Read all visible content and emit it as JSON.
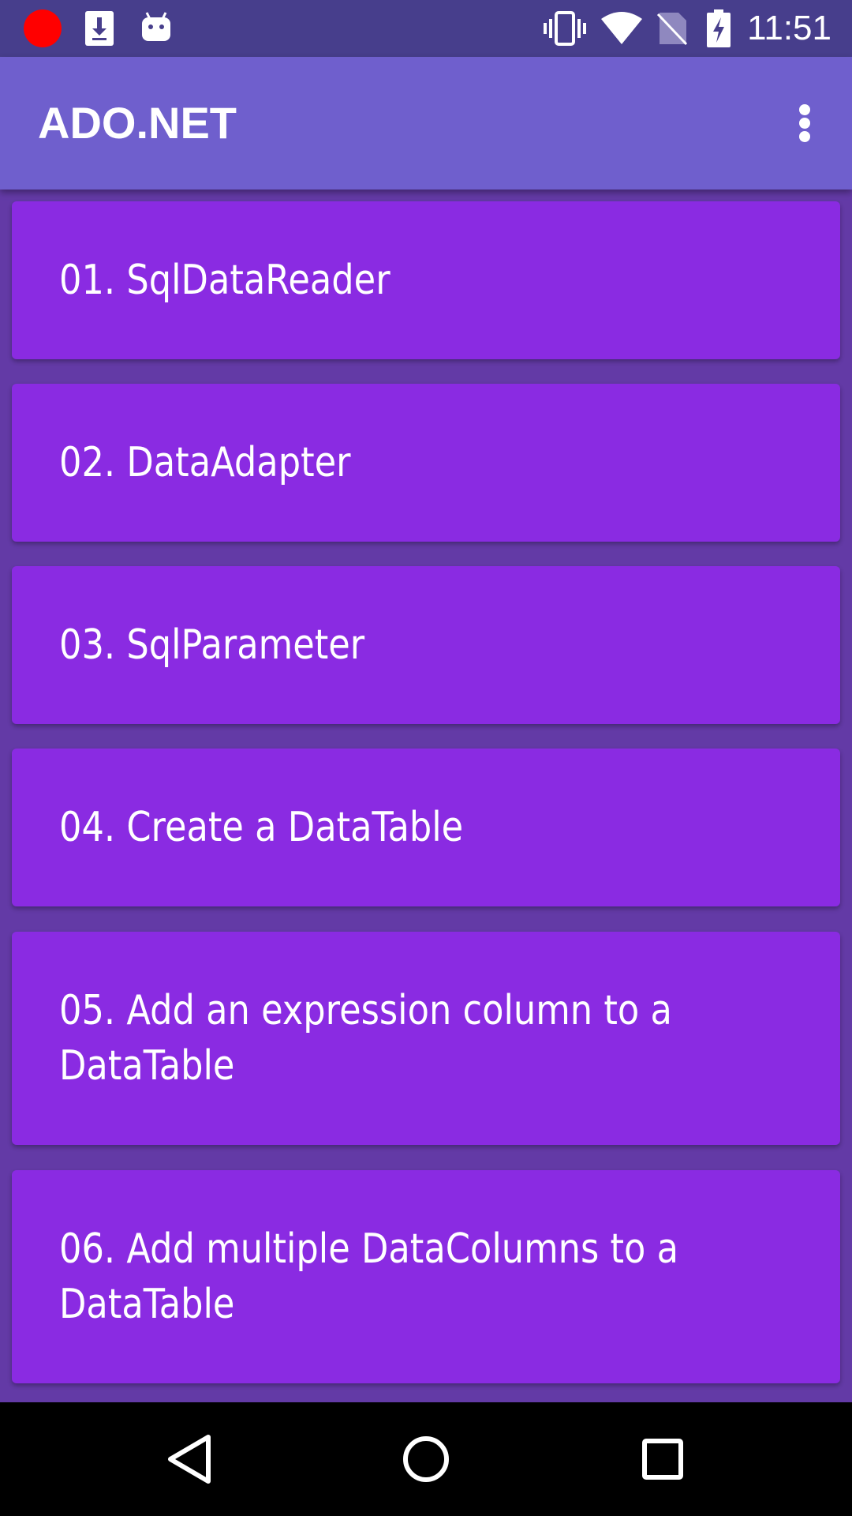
{
  "status_bar": {
    "time": "11:51",
    "icons": [
      "record-icon",
      "download-icon",
      "android-icon",
      "vibrate-icon",
      "wifi-icon",
      "no-sim-icon",
      "battery-charging-icon"
    ],
    "record_color": "#ff0000"
  },
  "app_bar": {
    "title": "ADO.NET",
    "menu_icon": "overflow-menu-icon"
  },
  "list": {
    "items": [
      {
        "label": "01. SqlDataReader"
      },
      {
        "label": "02. DataAdapter"
      },
      {
        "label": "03. SqlParameter"
      },
      {
        "label": "04. Create a DataTable"
      },
      {
        "label": "05. Add an expression column to a DataTable"
      },
      {
        "label": "06. Add multiple DataColumns to a DataTable"
      }
    ]
  },
  "nav_bar": {
    "buttons": [
      "back-icon",
      "home-icon",
      "recents-icon"
    ]
  },
  "colors": {
    "status_bar": "#473e8c",
    "app_bar": "#6f5fcd",
    "background": "#633aa6",
    "card": "#8a2be2",
    "text": "#ffffff"
  }
}
